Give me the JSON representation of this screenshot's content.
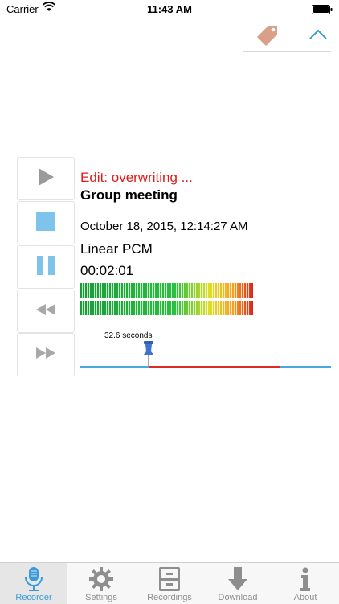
{
  "status_bar": {
    "carrier": "Carrier",
    "time": "11:43 AM"
  },
  "top_controls": {
    "tag_icon": "tag-icon",
    "collapse_icon": "chevron-up-icon"
  },
  "transport": {
    "play_icon": "play-icon",
    "stop_icon": "stop-icon",
    "pause_icon": "pause-icon",
    "rewind_icon": "rewind-icon",
    "fast_forward_icon": "fast-forward-icon"
  },
  "recording": {
    "edit_status": "Edit: overwriting ...",
    "title": "Group meeting",
    "date": "October 18, 2015, 12:14:27 AM",
    "format": "Linear PCM",
    "duration": "00:02:01"
  },
  "timeline": {
    "marker_label": "32.6 seconds"
  },
  "tab_bar": {
    "items": [
      {
        "label": "Recorder",
        "icon": "microphone-icon",
        "active": true
      },
      {
        "label": "Settings",
        "icon": "gear-icon",
        "active": false
      },
      {
        "label": "Recordings",
        "icon": "cabinet-icon",
        "active": false
      },
      {
        "label": "Download",
        "icon": "download-arrow-icon",
        "active": false
      },
      {
        "label": "About",
        "icon": "info-icon",
        "active": false
      }
    ]
  },
  "colors": {
    "accent": "#3a9ad9",
    "edit_red": "#e11b1b",
    "timeline_blue": "#4aa8e0",
    "timeline_red": "#e02a25"
  }
}
